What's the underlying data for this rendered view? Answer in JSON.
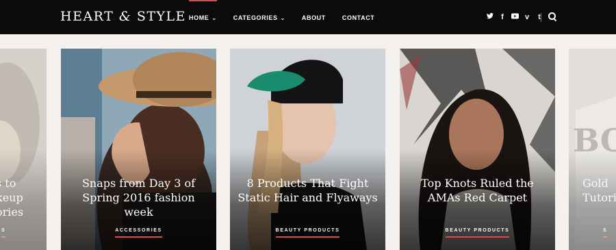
{
  "header": {
    "logo": {
      "part1": "HEART",
      "amp": "&",
      "part2": "STYLE"
    },
    "menu": [
      {
        "label": "HOME",
        "chevron": "⌄",
        "active": true
      },
      {
        "label": "CATEGORIES",
        "chevron": "⌄",
        "active": false
      },
      {
        "label": "ABOUT",
        "chevron": "",
        "active": false
      },
      {
        "label": "CONTACT",
        "chevron": "",
        "active": false
      }
    ],
    "social": [
      {
        "name": "twitter-icon",
        "glyph": "🐦"
      },
      {
        "name": "facebook-icon",
        "glyph": "f"
      },
      {
        "name": "youtube-icon",
        "glyph": "▶"
      },
      {
        "name": "vimeo-icon",
        "glyph": "v"
      },
      {
        "name": "tumblr-icon",
        "glyph": "t"
      }
    ],
    "accent": "#d94a4a"
  },
  "cards": [
    {
      "title_partial": "s to\nkeup\nories",
      "category": "S",
      "visible": "partial-left"
    },
    {
      "title": "Snaps from Day 3 of Spring 2016 fashion week",
      "category": "ACCESSORIES"
    },
    {
      "title": "8 Products That Fight Static Hair and Flyaways",
      "category": "BEAUTY PRODUCTS"
    },
    {
      "title": "Top Knots Ruled the AMAs Red Carpet",
      "category": "BEAUTY PRODUCTS"
    },
    {
      "title_partial": "Gold\nTutori",
      "category": "S",
      "visible": "partial-right"
    }
  ]
}
